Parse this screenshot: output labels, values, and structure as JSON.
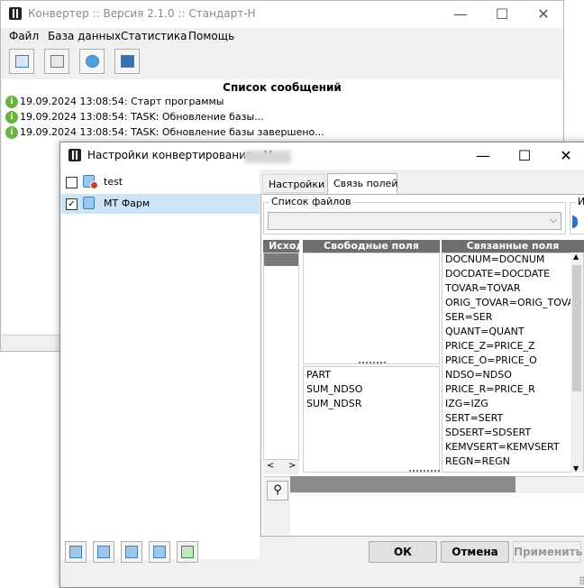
{
  "main_window": {
    "title": "Конвертер :: Версия 2.1.0 :: Стандарт-Н",
    "window_buttons": {
      "minimize": "—",
      "maximize": "☐",
      "close": "✕"
    },
    "menu": [
      "Файл",
      "База данных",
      "Статистика",
      "Помощь"
    ],
    "toolbar_icons": [
      "import-icon",
      "windows-icon",
      "refresh-icon",
      "monitor-icon"
    ],
    "messages_title": "Список сообщений",
    "messages": [
      {
        "icon": "info-icon",
        "text": "19.09.2024 13:08:54: Старт программы"
      },
      {
        "icon": "info-icon",
        "text": "19.09.2024 13:08:54: TASK: Обновление базы..."
      },
      {
        "icon": "info-icon",
        "text": "19.09.2024 13:08:54: TASK: Обновление базы завершено..."
      }
    ]
  },
  "dialog": {
    "title": "Настройки конвертирования - М",
    "window_buttons": {
      "minimize": "—",
      "maximize": "☐",
      "close": "✕"
    },
    "tree": [
      {
        "label": "test",
        "checked": false,
        "selected": false
      },
      {
        "label": "МТ Фарм",
        "checked": true,
        "selected": true
      }
    ],
    "tabs": [
      "Настройки",
      "Связь полей"
    ],
    "active_tab": "Связь полей",
    "file_list_label": "Список файлов",
    "file_list_value": "",
    "cut_group_label": "И",
    "columns": {
      "source": "Исход",
      "free": "Свободные поля",
      "linked": "Связанные поля"
    },
    "free_fields": [
      "PART",
      "SUM_NDSO",
      "SUM_NDSR"
    ],
    "linked_fields": [
      "DOCNUM=DOCNUM",
      "DOCDATE=DOCDATE",
      "TOVAR=TOVAR",
      "ORIG_TOVAR=ORIG_TOVAR",
      "SER=SER",
      "QUANT=QUANT",
      "PRICE_Z=PRICE_Z",
      "PRICE_O=PRICE_O",
      "NDSO=NDSO",
      "PRICE_R=PRICE_R",
      "IZG=IZG",
      "SERT=SERT",
      "SDSERT=SDSERT",
      "KEMVSERT=KEMVSERT",
      "REGN=REGN"
    ],
    "scroll_arrows": {
      "left": "<",
      "right": ">",
      "up": "▲",
      "down": "▼"
    },
    "buttons": {
      "ok": "ОК",
      "cancel": "Отмена",
      "apply": "Применить"
    }
  }
}
